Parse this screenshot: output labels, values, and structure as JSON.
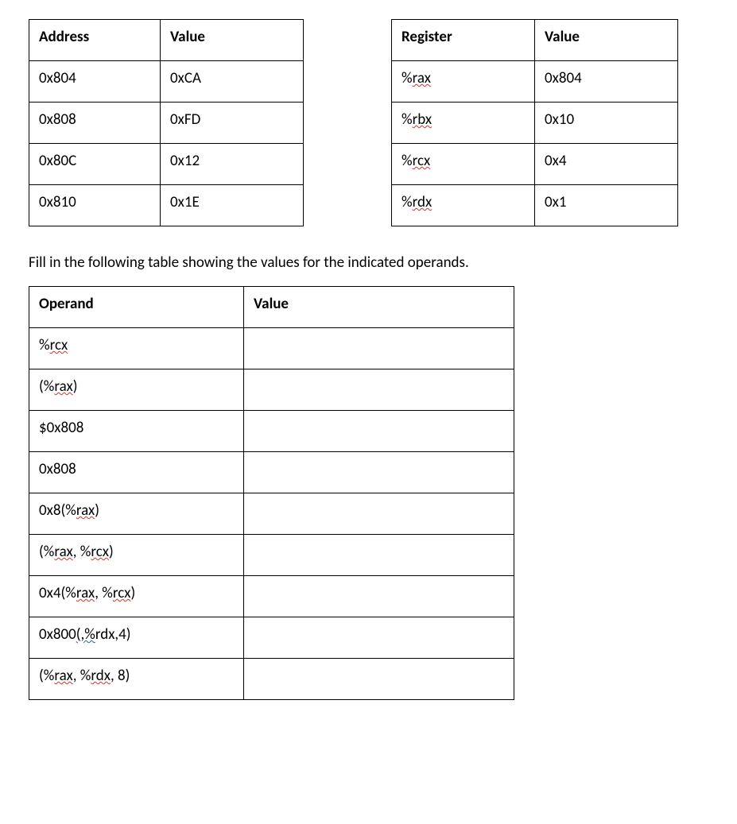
{
  "memory_table": {
    "headers": [
      "Address",
      "Value"
    ],
    "rows": [
      [
        "0x804",
        "0xCA"
      ],
      [
        "0x808",
        "0xFD"
      ],
      [
        "0x80C",
        "0x12"
      ],
      [
        "0x810",
        "0x1E"
      ]
    ]
  },
  "register_table": {
    "headers": [
      "Register",
      "Value"
    ],
    "rows": [
      {
        "reg_pre": "%",
        "reg_sq": "rax",
        "val": "0x804"
      },
      {
        "reg_pre": "%",
        "reg_sq": "rbx",
        "val": "0x10"
      },
      {
        "reg_pre": "%",
        "reg_sq": "rcx",
        "val": "0x4"
      },
      {
        "reg_pre": "%",
        "reg_sq": "rdx",
        "val": "0x1"
      }
    ]
  },
  "instruction": "Fill in the following table showing the values for the indicated operands.",
  "operand_table": {
    "headers": [
      "Operand",
      "Value"
    ],
    "rows": [
      {
        "parts": [
          {
            "t": "%"
          },
          {
            "t": "rcx",
            "c": "squig"
          }
        ]
      },
      {
        "parts": [
          {
            "t": "(%"
          },
          {
            "t": "rax",
            "c": "squig"
          },
          {
            "t": ")"
          }
        ]
      },
      {
        "parts": [
          {
            "t": "$0x808"
          }
        ]
      },
      {
        "parts": [
          {
            "t": "0x808"
          }
        ]
      },
      {
        "parts": [
          {
            "t": "0x8(%"
          },
          {
            "t": "rax",
            "c": "squig"
          },
          {
            "t": ")"
          }
        ]
      },
      {
        "parts": [
          {
            "t": "(%"
          },
          {
            "t": "rax",
            "c": "squig"
          },
          {
            "t": ", %"
          },
          {
            "t": "rcx",
            "c": "squig"
          },
          {
            "t": ")"
          }
        ]
      },
      {
        "parts": [
          {
            "t": "0x4(%"
          },
          {
            "t": "rax",
            "c": "squig"
          },
          {
            "t": ", %"
          },
          {
            "t": "rcx",
            "c": "squig"
          },
          {
            "t": ")"
          }
        ]
      },
      {
        "parts": [
          {
            "t": "0x800"
          },
          {
            "t": "(,%",
            "c": "squig-blue"
          },
          {
            "t": "rdx,4)"
          }
        ]
      },
      {
        "parts": [
          {
            "t": "(%"
          },
          {
            "t": "rax",
            "c": "squig"
          },
          {
            "t": ", %"
          },
          {
            "t": "rdx",
            "c": "squig"
          },
          {
            "t": ", 8)"
          }
        ]
      }
    ]
  }
}
